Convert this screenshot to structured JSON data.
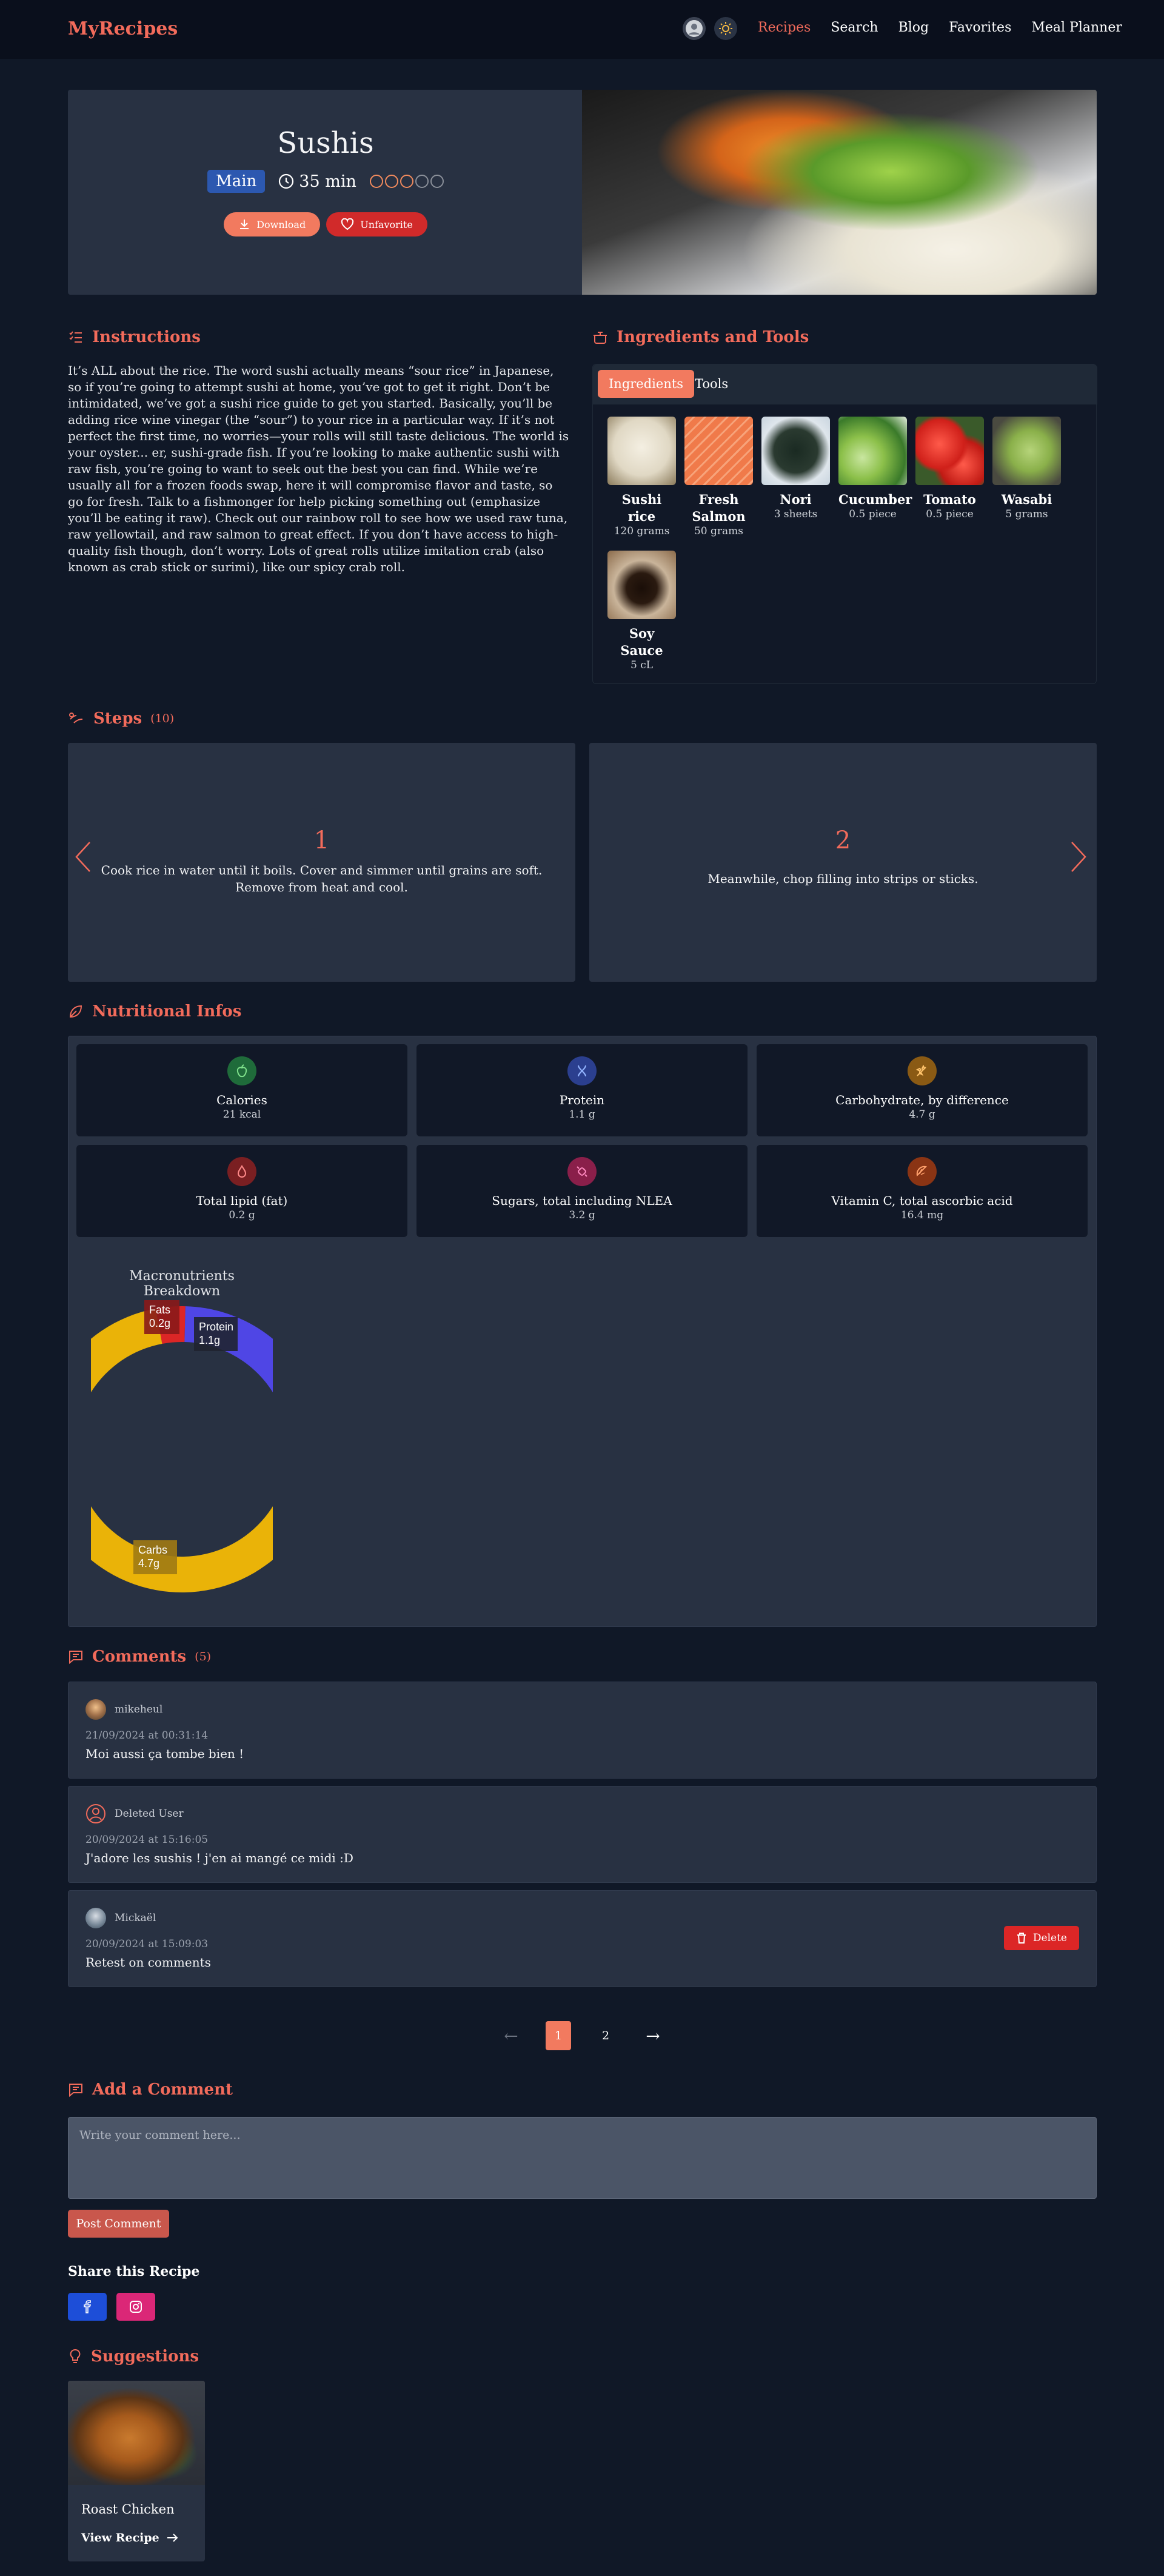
{
  "nav": {
    "logo": "MyRecipes",
    "links": [
      {
        "label": "Recipes",
        "active": true
      },
      {
        "label": "Search",
        "active": false
      },
      {
        "label": "Blog",
        "active": false
      },
      {
        "label": "Favorites",
        "active": false
      },
      {
        "label": "Meal Planner",
        "active": false
      }
    ]
  },
  "recipe": {
    "title": "Sushis",
    "category": "Main",
    "time": "35 min",
    "difficulty": {
      "level": 3,
      "max": 5
    },
    "download_label": "Download",
    "unfavorite_label": "Unfavorite"
  },
  "instructions": {
    "heading": "Instructions",
    "text": "It’s ALL about the rice. The word sushi actually means “sour rice” in Japanese, so if you’re going to attempt sushi at home, you’ve got to get it right. Don’t be intimidated, we’ve got a sushi rice guide to get you started. Basically, you’ll be adding rice wine vinegar (the “sour”) to your rice in a particular way. If it’s not perfect the first time, no worries—your rolls will still taste delicious. The world is your oyster... er, sushi-grade fish. If you’re looking to make authentic sushi with raw fish, you’re going to want to seek out the best you can find. While we’re usually all for a frozen foods swap, here it will compromise flavor and taste, so go for fresh. Talk to a fishmonger for help picking something out (emphasize you’ll be eating it raw). Check out our rainbow roll to see how we used raw tuna, raw yellowtail, and raw salmon to great effect. If you don’t have access to high-quality fish though, don’t worry. Lots of great rolls utilize imitation crab (also known as crab stick or surimi), like our spicy crab roll."
  },
  "ingredients_section": {
    "heading": "Ingredients and Tools",
    "tabs": [
      "Ingredients",
      "Tools"
    ],
    "items": [
      {
        "name": "Sushi rice",
        "qty": "120 grams"
      },
      {
        "name": "Fresh Salmon",
        "qty": "50 grams"
      },
      {
        "name": "Nori",
        "qty": "3 sheets"
      },
      {
        "name": "Cucumber",
        "qty": "0.5 piece"
      },
      {
        "name": "Tomato",
        "qty": "0.5 piece"
      },
      {
        "name": "Wasabi",
        "qty": "5 grams"
      },
      {
        "name": "Soy Sauce",
        "qty": "5 cL"
      }
    ]
  },
  "steps": {
    "heading": "Steps",
    "count": "(10)",
    "cards": [
      {
        "number": "1",
        "text": "Cook rice in water until it boils. Cover and simmer until grains are soft. Remove from heat and cool."
      },
      {
        "number": "2",
        "text": "Meanwhile, chop filling into strips or sticks."
      }
    ]
  },
  "nutrition": {
    "heading": "Nutritional Infos",
    "items": [
      {
        "label": "Calories",
        "value": "21 kcal"
      },
      {
        "label": "Protein",
        "value": "1.1 g"
      },
      {
        "label": "Carbohydrate, by difference",
        "value": "4.7 g"
      },
      {
        "label": "Total lipid (fat)",
        "value": "0.2 g"
      },
      {
        "label": "Sugars, total including NLEA",
        "value": "3.2 g"
      },
      {
        "label": "Vitamin C, total ascorbic acid",
        "value": "16.4 mg"
      }
    ],
    "colors": {
      "calories": "#1f6b3a",
      "protein": "#2b3f8f",
      "carbs": "#8a5a14",
      "fat": "#7a1f22",
      "sugars": "#8a1f4a",
      "vitc": "#8a3414"
    }
  },
  "chart_data": {
    "type": "pie",
    "title": "Macronutrients Breakdown",
    "categories": [
      "Protein",
      "Carbs",
      "Fats"
    ],
    "values": [
      1.1,
      4.7,
      0.2
    ],
    "labels": [
      "Protein\n1.1g",
      "Carbs\n4.7g",
      "Fats\n0.2g"
    ],
    "colors": [
      "#4f46e5",
      "#eab308",
      "#dc2626"
    ],
    "legend": "none"
  },
  "comments": {
    "heading": "Comments",
    "count": "(5)",
    "items": [
      {
        "user": "mikeheul",
        "date": "21/09/2024 at 00:31:14",
        "text": "Moi aussi ça tombe bien !",
        "deletable": false
      },
      {
        "user": "Deleted User",
        "date": "20/09/2024 at 15:16:05",
        "text": "J'adore les sushis ! j'en ai mangé ce midi :D",
        "deletable": false
      },
      {
        "user": "Mickaël",
        "date": "20/09/2024 at 15:09:03",
        "text": "Retest on comments",
        "deletable": true
      }
    ],
    "delete_label": "Delete",
    "pagination": {
      "prev": "←",
      "pages": [
        "1",
        "2"
      ],
      "current": "1",
      "next": "→"
    }
  },
  "add_comment": {
    "heading": "Add a Comment",
    "placeholder": "Write your comment here...",
    "button": "Post Comment"
  },
  "share": {
    "heading": "Share this Recipe",
    "colors": {
      "facebook": "#1d4ed8",
      "instagram": "#db2777"
    }
  },
  "suggestions": {
    "heading": "Suggestions",
    "items": [
      {
        "name": "Roast Chicken",
        "link": "View Recipe"
      }
    ]
  }
}
